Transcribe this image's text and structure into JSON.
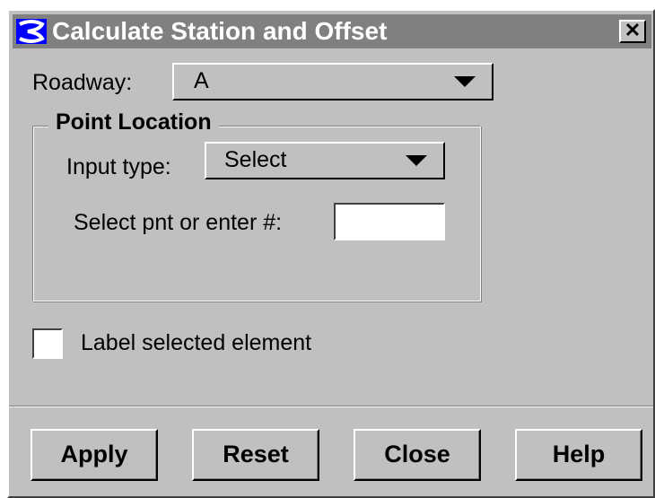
{
  "window": {
    "title": "Calculate Station and Offset",
    "close_label": "✕",
    "icon": "app-logo-icon"
  },
  "roadway": {
    "label": "Roadway:",
    "value": "A"
  },
  "point_location": {
    "title": "Point Location",
    "input_type_label": "Input type:",
    "input_type_value": "Select",
    "select_label": "Select pnt or enter #:",
    "select_value": ""
  },
  "label_element": {
    "label": "Label selected element",
    "checked": false
  },
  "buttons": {
    "apply": "Apply",
    "reset": "Reset",
    "close": "Close",
    "help": "Help"
  },
  "colors": {
    "face": "#c0c0c0",
    "titlebar": "#808080",
    "icon_blue": "#0000ff"
  }
}
